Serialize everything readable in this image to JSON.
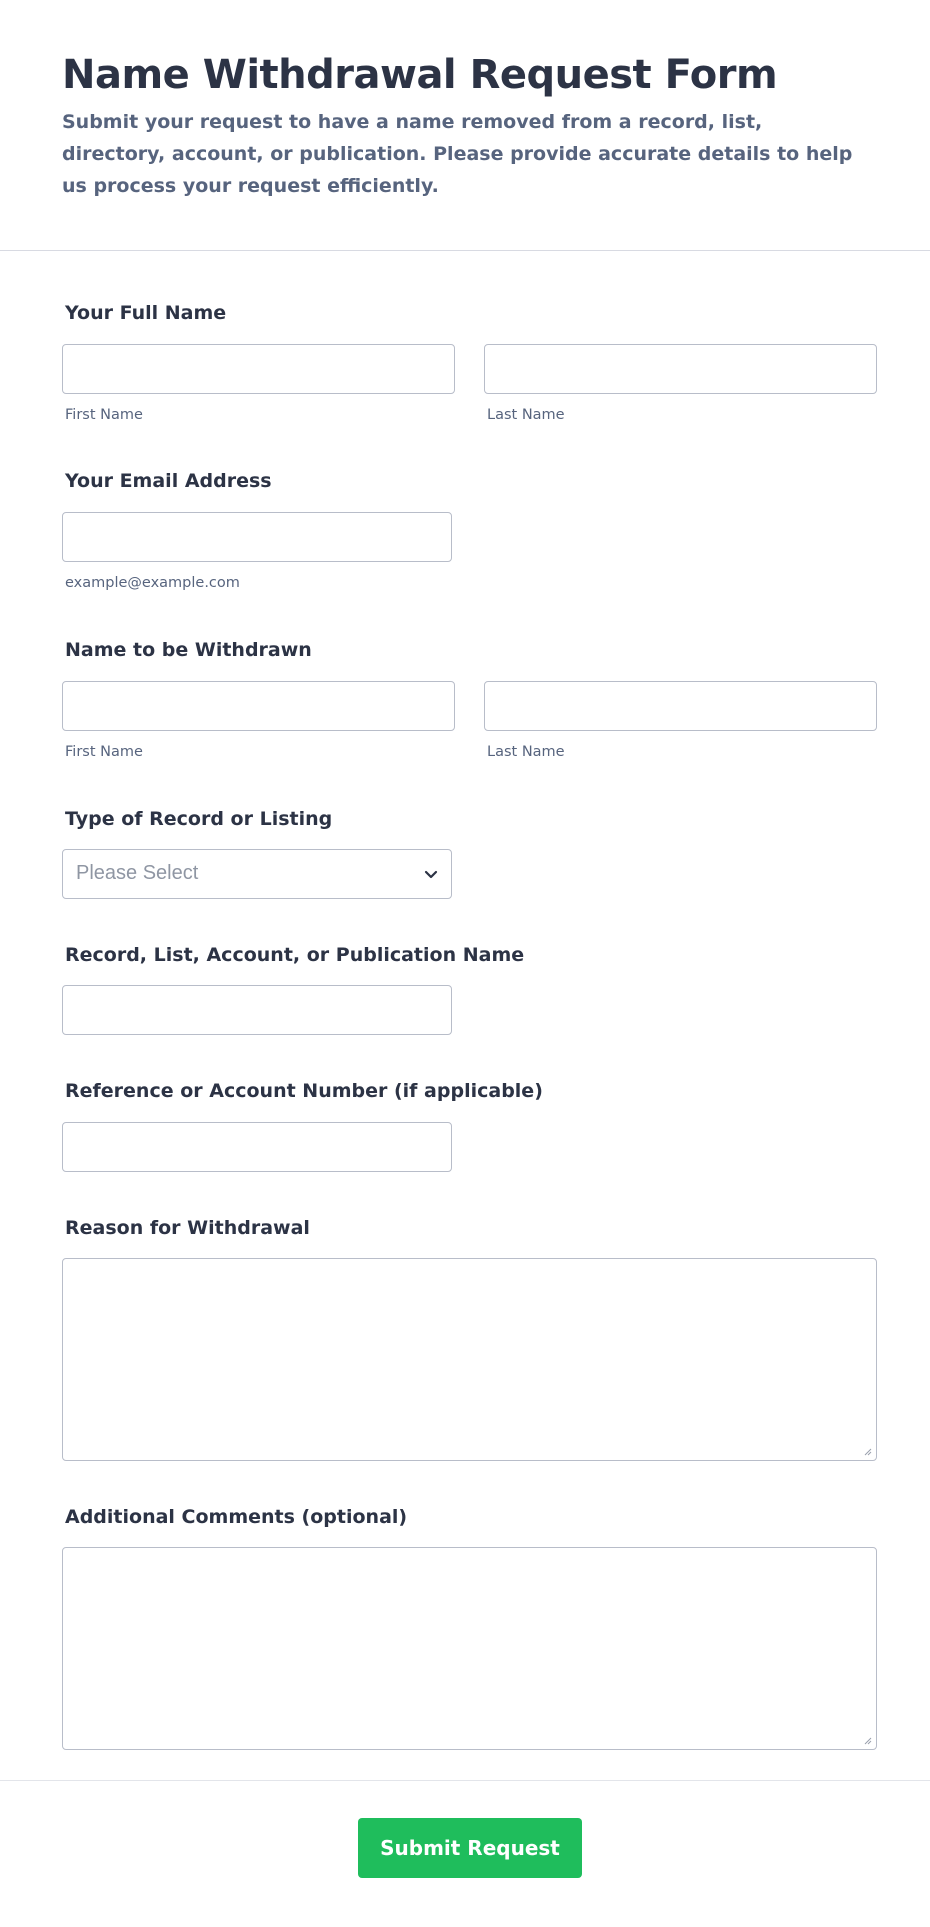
{
  "header": {
    "title": "Name Withdrawal Request Form",
    "subtitle": "Submit your request to have a name removed from a record, list, directory, account, or publication. Please provide accurate details to help us process your request efficiently."
  },
  "fields": {
    "full_name": {
      "label": "Your Full Name",
      "first_sublabel": "First Name",
      "last_sublabel": "Last Name",
      "first_value": "",
      "last_value": ""
    },
    "email": {
      "label": "Your Email Address",
      "sublabel": "example@example.com",
      "value": ""
    },
    "withdraw_name": {
      "label": "Name to be Withdrawn",
      "first_sublabel": "First Name",
      "last_sublabel": "Last Name",
      "first_value": "",
      "last_value": ""
    },
    "record_type": {
      "label": "Type of Record or Listing",
      "selected": "Please Select",
      "icon": "chevron-down-icon"
    },
    "record_name": {
      "label": "Record, List, Account, or Publication Name",
      "value": ""
    },
    "reference": {
      "label": "Reference or Account Number (if applicable)",
      "value": ""
    },
    "reason": {
      "label": "Reason for Withdrawal",
      "value": ""
    },
    "comments": {
      "label": "Additional Comments (optional)",
      "value": ""
    }
  },
  "submit": {
    "label": "Submit Request",
    "color": "#1fbd5c"
  }
}
